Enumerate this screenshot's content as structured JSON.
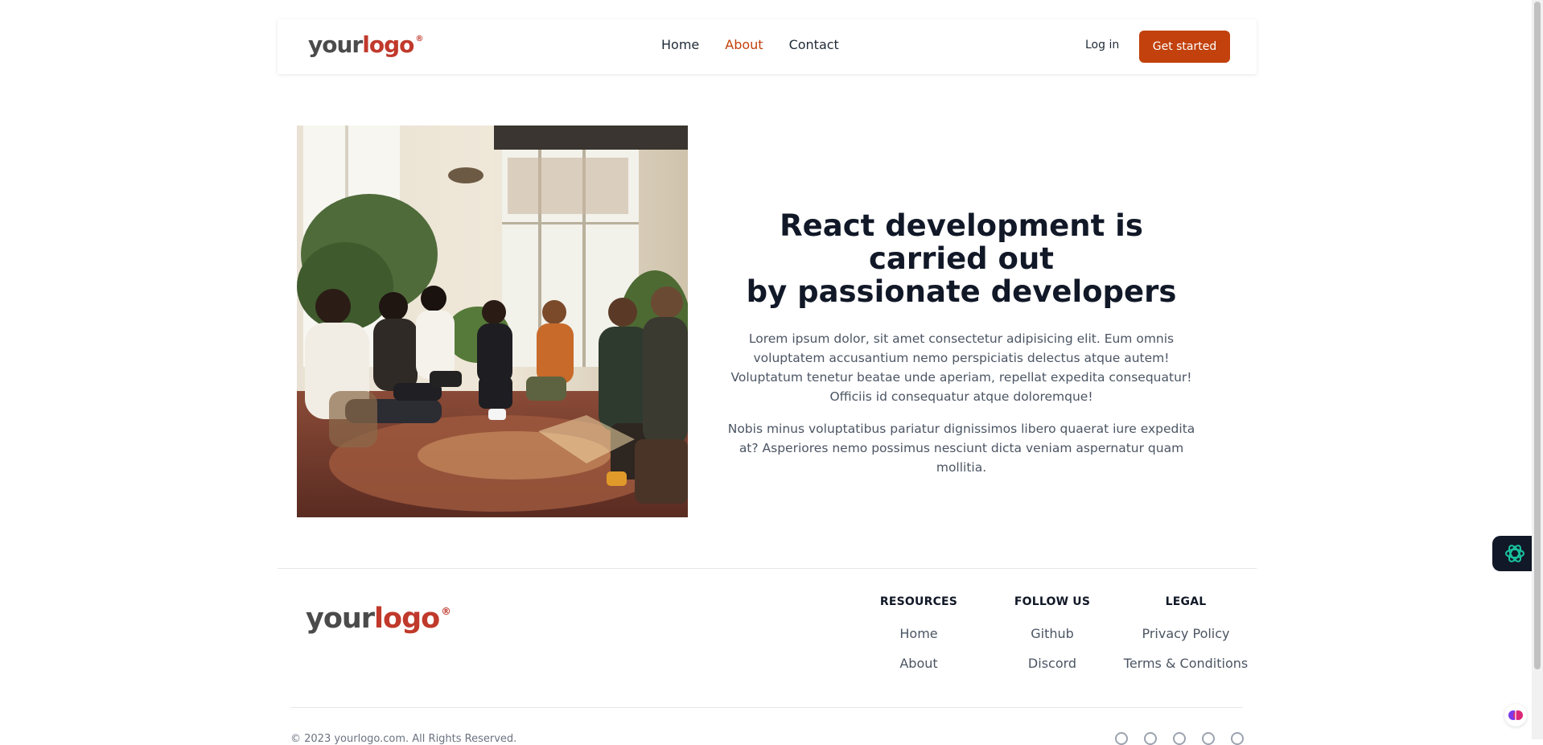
{
  "header": {
    "logo": {
      "word1": "your",
      "word2": "logo",
      "mark": "®"
    },
    "nav": [
      {
        "label": "Home",
        "active": false
      },
      {
        "label": "About",
        "active": true
      },
      {
        "label": "Contact",
        "active": false
      }
    ],
    "login_label": "Log in",
    "cta_label": "Get started"
  },
  "hero": {
    "image_icon": "photo-group-discussion",
    "title_line1": "React development is carried out",
    "title_line2": "by passionate developers",
    "paragraph1": "Lorem ipsum dolor, sit amet consectetur adipisicing elit. Eum omnis voluptatem accusantium nemo perspiciatis delectus atque autem! Voluptatum tenetur beatae unde aperiam, repellat expedita consequatur! Officiis id consequatur atque doloremque!",
    "paragraph2": "Nobis minus voluptatibus pariatur dignissimos libero quaerat iure expedita at? Asperiores nemo possimus nesciunt dicta veniam aspernatur quam mollitia."
  },
  "footer": {
    "logo": {
      "word1": "your",
      "word2": "logo",
      "mark": "®"
    },
    "columns": [
      {
        "heading": "RESOURCES",
        "links": [
          "Home",
          "About"
        ]
      },
      {
        "heading": "FOLLOW US",
        "links": [
          "Github",
          "Discord"
        ]
      },
      {
        "heading": "LEGAL",
        "links": [
          "Privacy Policy",
          "Terms & Conditions"
        ]
      }
    ],
    "copyright": "© 2023 yourlogo.com. All Rights Reserved.",
    "social_icons": [
      "facebook-icon",
      "discord-icon",
      "twitter-icon",
      "github-icon",
      "dribbble-icon"
    ]
  },
  "widgets": {
    "ai_icon": "openai-icon",
    "brain_icon": "brain-icon"
  },
  "colors": {
    "accent": "#c2410c",
    "logo_red": "#c0392b",
    "logo_gray": "#4b4b4b",
    "heading": "#111827",
    "body_text": "#4b5563"
  }
}
